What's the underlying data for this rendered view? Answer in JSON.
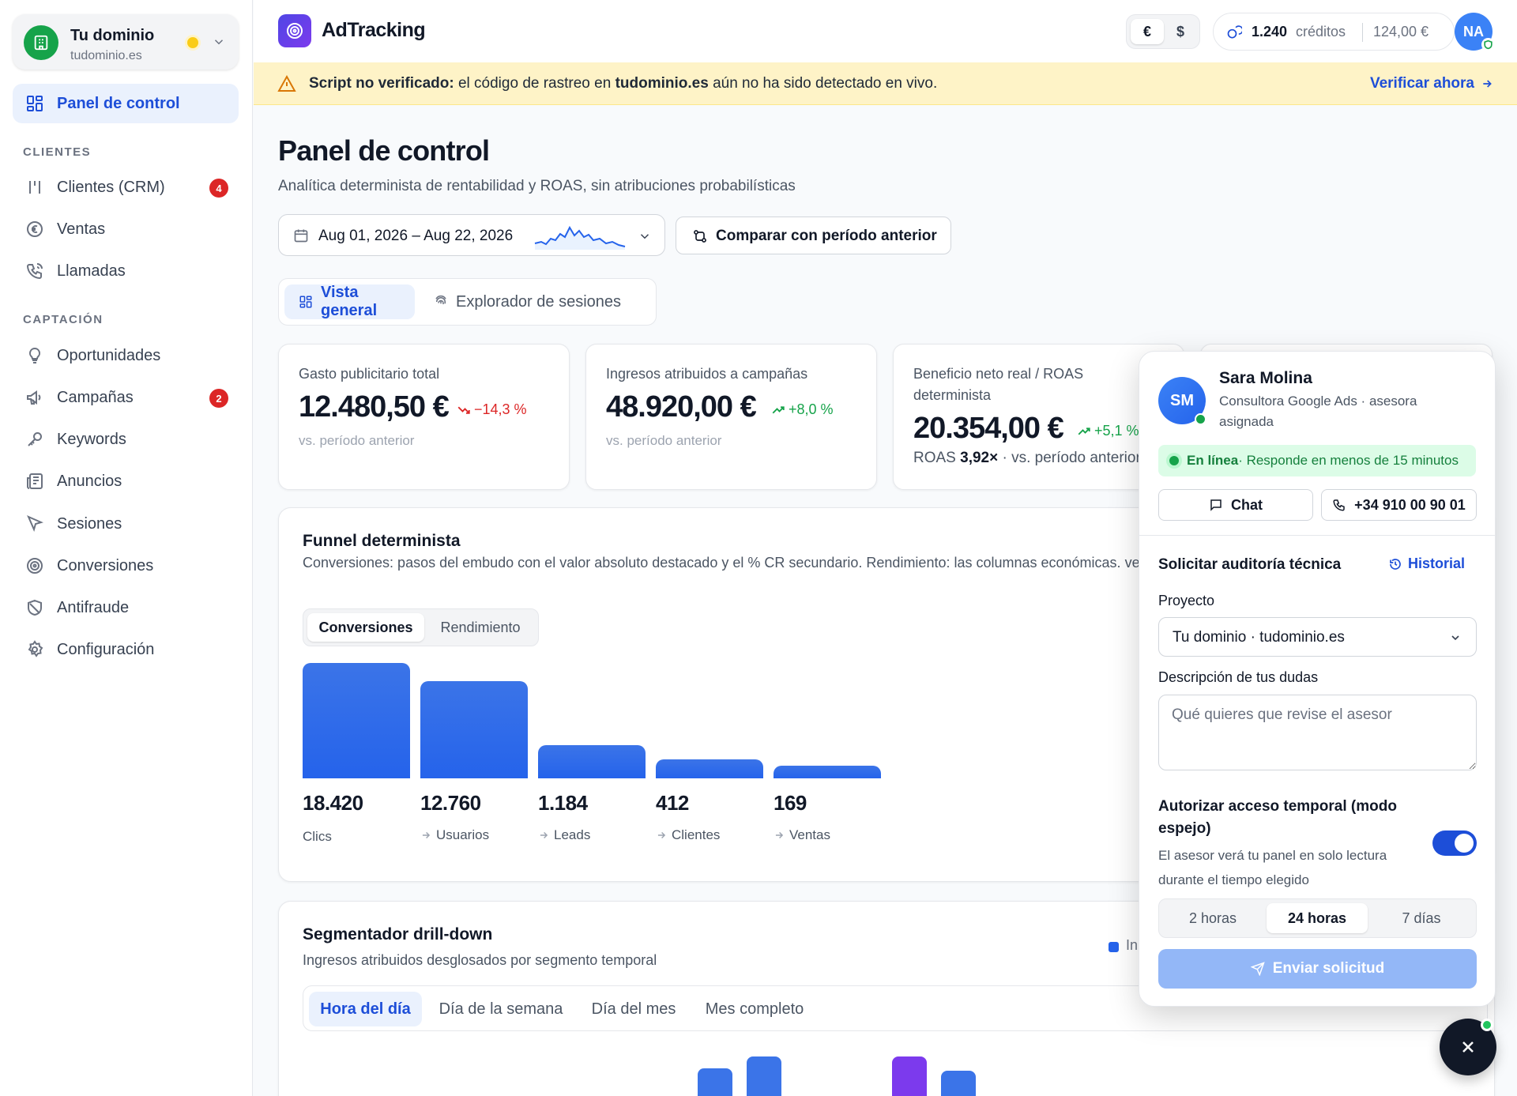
{
  "sidebar": {
    "domain": {
      "name": "Tu dominio",
      "url": "tudominio.es"
    },
    "active_item": {
      "label": "Panel de control",
      "icon": "dashboard-icon"
    },
    "sections": [
      {
        "label": "CLIENTES",
        "items": [
          {
            "label": "Clientes (CRM)",
            "icon": "bar-chart-icon",
            "badge": "4"
          },
          {
            "label": "Ventas",
            "icon": "euro-icon"
          },
          {
            "label": "Llamadas",
            "icon": "phone-icon"
          }
        ]
      },
      {
        "label": "CAPTACIÓN",
        "items": [
          {
            "label": "Oportunidades",
            "icon": "lightbulb-icon"
          },
          {
            "label": "Campañas",
            "icon": "megaphone-icon",
            "badge": "2"
          },
          {
            "label": "Keywords",
            "icon": "key-icon"
          },
          {
            "label": "Anuncios",
            "icon": "newspaper-icon"
          },
          {
            "label": "Sesiones",
            "icon": "cursor-icon"
          },
          {
            "label": "Conversiones",
            "icon": "target-icon"
          },
          {
            "label": "Antifraude",
            "icon": "shield-off-icon"
          },
          {
            "label": "Configuración",
            "icon": "gear-icon"
          }
        ]
      }
    ]
  },
  "topbar": {
    "app_name": "AdTracking",
    "currencies": [
      "€",
      "$"
    ],
    "active_currency": "€",
    "credits": {
      "count": "1.240",
      "label": "créditos",
      "value": "124,00 €"
    },
    "avatar_initials": "NA"
  },
  "warning": {
    "bold": "Script no verificado:",
    "text_1": " el código de rastreo en ",
    "domain": "tudominio.es",
    "text_2": " aún no ha sido detectado en vivo.",
    "link": "Verificar ahora"
  },
  "page": {
    "title": "Panel de control",
    "subtitle": "Analítica determinista de rentabilidad y ROAS, sin atribuciones probabilísticas",
    "date_range": "Aug 01, 2026 – Aug 22, 2026",
    "compare_label": "Comparar con período anterior",
    "view_tabs": [
      "Vista general",
      "Explorador de sesiones"
    ]
  },
  "kpis": [
    {
      "label": "Gasto publicitario total",
      "value": "12.480,50 €",
      "delta": "−14,3 %",
      "trend": "down",
      "foot": "vs. período anterior"
    },
    {
      "label": "Ingresos atribuidos a campañas",
      "value": "48.920,00 €",
      "delta": "+8,0 %",
      "trend": "up",
      "foot": "vs. período anterior"
    },
    {
      "label": "Beneficio neto real / ROAS determinista",
      "value": "20.354,00 €",
      "delta": "+5,1 %",
      "trend": "up",
      "foot_prefix": "ROAS ",
      "foot_roas": "3,92×",
      "foot_suffix": " · vs. período anterior"
    }
  ],
  "funnel": {
    "title": "Funnel determinista",
    "subtitle": "Conversiones: pasos del embudo con el valor absoluto destacado y el % CR secundario. Rendimiento: las columnas económicas. verificados.",
    "tabs": [
      "Conversiones",
      "Rendimiento"
    ],
    "steps": [
      {
        "value": "18.420",
        "label": "Clics"
      },
      {
        "value": "12.760",
        "label": "Usuarios"
      },
      {
        "value": "1.184",
        "label": "Leads"
      },
      {
        "value": "412",
        "label": "Clientes"
      },
      {
        "value": "169",
        "label": "Ventas"
      }
    ]
  },
  "segmenter": {
    "title": "Segmentador drill-down",
    "subtitle": "Ingresos atribuidos desglosados por segmento temporal",
    "legend": "In",
    "tabs": [
      "Hora del día",
      "Día de la semana",
      "Día del mes",
      "Mes completo"
    ]
  },
  "advisor": {
    "initials": "SM",
    "name": "Sara Molina",
    "role": "Consultora Google Ads · asesora asignada",
    "status_bold": "En línea",
    "status_text": " · Responde en menos de 15 minutos",
    "chat_label": "Chat",
    "phone": "+34 910 00 90 01",
    "request_title": "Solicitar auditoría técnica",
    "history_label": "Historial",
    "project_label": "Proyecto",
    "project_value": "Tu dominio · tudominio.es",
    "doubts_label": "Descripción de tus dudas",
    "doubts_placeholder": "Qué quieres que revise el asesor",
    "auth_title": "Autorizar acceso temporal (modo espejo)",
    "auth_desc": "El asesor verá tu panel en solo lectura durante el tiempo elegido",
    "auth_enabled": true,
    "durations": [
      "2 horas",
      "24 horas",
      "7 días"
    ],
    "active_duration": "24 horas",
    "send_label": "Enviar solicitud"
  },
  "colors": {
    "accent": "#1d4ed8",
    "bar": "#2563eb",
    "warning_bg": "#fef3c7",
    "online": "#16a34a",
    "danger": "#dc2626"
  }
}
